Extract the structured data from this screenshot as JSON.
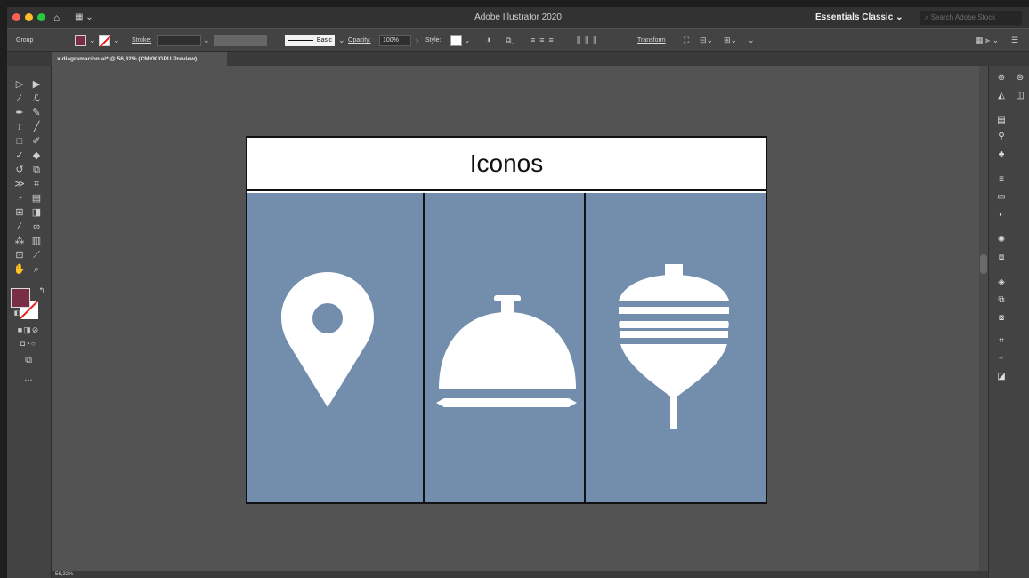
{
  "titlebar": {
    "app_title": "Adobe Illustrator 2020",
    "workspace": "Essentials Classic",
    "search_placeholder": "Search Adobe Stock"
  },
  "controlbar": {
    "selection_label": "Group",
    "fill_color": "#7a2e45",
    "stroke_label": "Stroke:",
    "brush_label": "Basic",
    "opacity_label": "Opacity:",
    "opacity_value": "100%",
    "style_label": "Style:",
    "transform_label": "Transform"
  },
  "document": {
    "tab_label": "diagramacion.ai* @ 56,32% (CMYK/GPU Preview)"
  },
  "tools": {
    "fill_swatch": "#7a2e45",
    "more_label": "..."
  },
  "statusbar": {
    "zoom": "56,32%"
  },
  "artboard": {
    "title": "Iconos",
    "panel_color": "#738ead",
    "icons": [
      {
        "name": "location-pin-icon"
      },
      {
        "name": "serving-cloche-icon"
      },
      {
        "name": "spinning-top-icon"
      }
    ]
  }
}
